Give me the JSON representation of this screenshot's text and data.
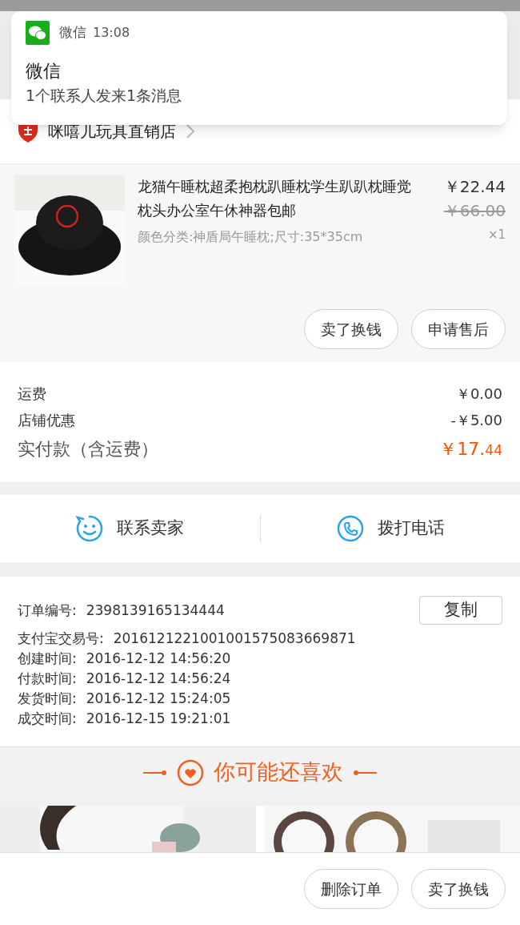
{
  "notification": {
    "app": "微信",
    "time": "13:08",
    "title": "微信",
    "message": "1个联系人发来1条消息"
  },
  "shop": {
    "name": "咪嘻儿玩具直销店"
  },
  "product": {
    "title": "龙猫午睡枕超柔抱枕趴睡枕学生趴趴枕睡觉枕头办公室午休神器包邮",
    "spec": "颜色分类:神盾局午睡枕;尺寸:35*35cm",
    "price": "￥22.44",
    "original_price": "￥66.00",
    "quantity": "×1",
    "actions": [
      "卖了换钱",
      "申请售后"
    ]
  },
  "fees": [
    {
      "label": "运费",
      "value": "￥0.00",
      "kind": "normal"
    },
    {
      "label": "店铺优惠",
      "value": "-￥5.00",
      "kind": "normal"
    },
    {
      "label": "实付款（含运费）",
      "value": "￥17.",
      "value_small": "44",
      "kind": "total"
    }
  ],
  "contact": [
    {
      "label": "联系卖家",
      "kind": "chat"
    },
    {
      "label": "拨打电话",
      "kind": "phone"
    }
  ],
  "order_info": [
    {
      "label": "订单编号:",
      "value": "2398139165134444"
    },
    {
      "label": "支付宝交易号:",
      "value": "2016121221001001575083669871"
    },
    {
      "label": "创建时间:",
      "value": "2016-12-12 14:56:20"
    },
    {
      "label": "付款时间:",
      "value": "2016-12-12 14:56:24"
    },
    {
      "label": "发货时间:",
      "value": "2016-12-12 15:24:05"
    },
    {
      "label": "成交时间:",
      "value": "2016-12-15 19:21:01"
    }
  ],
  "copy_button": "复制",
  "recommend": {
    "title": "你可能还喜欢"
  },
  "bottom_actions": [
    "删除订单",
    "卖了换钱"
  ]
}
